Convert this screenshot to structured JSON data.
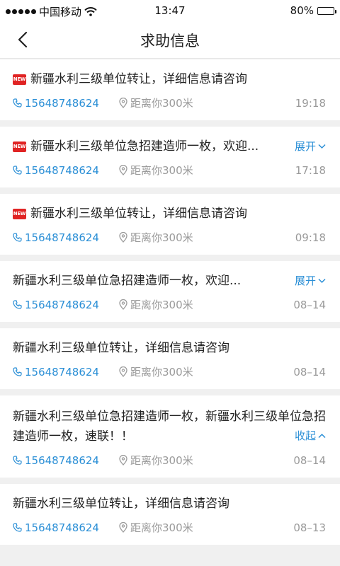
{
  "status": {
    "carrier": "中国移动",
    "time": "13:47",
    "battery": "80%",
    "battery_level": 0.8
  },
  "nav": {
    "title": "求助信息"
  },
  "badge_text": "NEW",
  "items": [
    {
      "new": true,
      "text": "新疆水利三级单位转让，详细信息请咨询",
      "phone": "15648748624",
      "distance": "距离你300米",
      "time": "19:18",
      "toggle": ""
    },
    {
      "new": true,
      "text": "新疆水利三级单位急招建造师一枚，欢迎...",
      "phone": "15648748624",
      "distance": "距离你300米",
      "time": "17:18",
      "toggle": "展开"
    },
    {
      "new": true,
      "text": "新疆水利三级单位转让，详细信息请咨询",
      "phone": "15648748624",
      "distance": "距离你300米",
      "time": "09:18",
      "toggle": ""
    },
    {
      "new": false,
      "text": "新疆水利三级单位急招建造师一枚，欢迎...",
      "phone": "15648748624",
      "distance": "距离你300米",
      "time": "08–14",
      "toggle": "展开"
    },
    {
      "new": false,
      "text": "新疆水利三级单位转让，详细信息请咨询",
      "phone": "15648748624",
      "distance": "距离你300米",
      "time": "08–14",
      "toggle": ""
    },
    {
      "new": false,
      "text": "新疆水利三级单位急招建造师一枚，新疆水利三级单位急招建造师一枚，速联！！",
      "phone": "15648748624",
      "distance": "距离你300米",
      "time": "08–14",
      "toggle": "收起"
    },
    {
      "new": false,
      "text": "新疆水利三级单位转让，详细信息请咨询",
      "phone": "15648748624",
      "distance": "距离你300米",
      "time": "08–13",
      "toggle": ""
    }
  ]
}
